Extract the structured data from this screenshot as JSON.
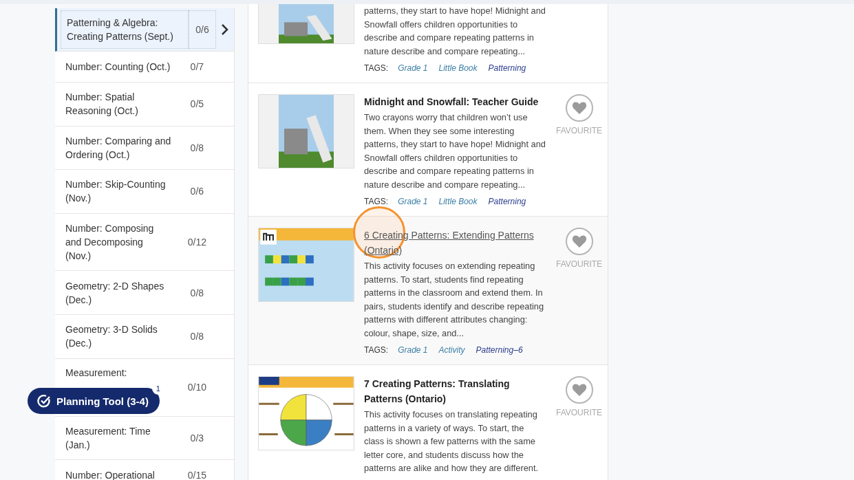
{
  "sidebar": {
    "items": [
      {
        "label": "Patterning & Algebra: Creating Patterns (Sept.)",
        "count": "0/6",
        "selected": true
      },
      {
        "label": "Number: Counting (Oct.)",
        "count": "0/7",
        "selected": false
      },
      {
        "label": "Number: Spatial Reasoning (Oct.)",
        "count": "0/5",
        "selected": false
      },
      {
        "label": "Number: Comparing and Ordering (Oct.)",
        "count": "0/8",
        "selected": false
      },
      {
        "label": "Number: Skip-Counting (Nov.)",
        "count": "0/6",
        "selected": false
      },
      {
        "label": "Number: Composing and Decomposing (Nov.)",
        "count": "0/12",
        "selected": false
      },
      {
        "label": "Geometry: 2-D Shapes (Dec.)",
        "count": "0/8",
        "selected": false
      },
      {
        "label": "Geometry: 3-D Solids (Dec.)",
        "count": "0/8",
        "selected": false
      },
      {
        "label": "Measurement:",
        "count": "0/10",
        "selected": false
      },
      {
        "label": "Measurement: Time (Jan.)",
        "count": "0/3",
        "selected": false
      },
      {
        "label": "Number: Operational",
        "count": "0/15",
        "selected": false
      }
    ]
  },
  "planning_tool": {
    "label": "Planning Tool (3-4)",
    "badge": "1"
  },
  "resources": [
    {
      "kind": "book",
      "description": "patterns, they start to have hope! Midnight and Snowfall offers children opportunities to describe and compare repeating patterns in nature describe and compare repeating...",
      "tags_label": "TAGS:",
      "tags": [
        {
          "label": "Grade 1",
          "color": "#3b7fa6"
        },
        {
          "label": "Little Book",
          "color": "#3b7fa6"
        },
        {
          "label": "Patterning",
          "color": "#2b3e8e"
        }
      ],
      "hovered": false
    },
    {
      "kind": "book",
      "title": "Midnight and Snowfall: Teacher Guide",
      "description": "Two crayons worry that children won’t use them. When they see some interesting patterns, they start to have hope! Midnight and Snowfall offers children opportunities to describe and compare repeating patterns in nature describe and compare repeating...",
      "tags_label": "TAGS:",
      "tags": [
        {
          "label": "Grade 1",
          "color": "#3b7fa6"
        },
        {
          "label": "Little Book",
          "color": "#3b7fa6"
        },
        {
          "label": "Patterning",
          "color": "#2b3e8e"
        }
      ],
      "favourite": "FAVOURITE",
      "hovered": false
    },
    {
      "kind": "squares",
      "title": "6 Creating Patterns: Extending Patterns (Ontario)",
      "description": "This activity focuses on extending repeating patterns. To start, students find repeating patterns in the classroom and extend them. In pairs, students identify and describe repeating patterns with different attributes changing: colour, shape, size, and...",
      "tags_label": "TAGS:",
      "tags": [
        {
          "label": "Grade 1",
          "color": "#3b7fa6"
        },
        {
          "label": "Activity",
          "color": "#3b7fa6"
        },
        {
          "label": "Patterning–6",
          "color": "#2b3e8e"
        }
      ],
      "favourite": "FAVOURITE",
      "hovered": true
    },
    {
      "kind": "circle",
      "title": "7 Creating Patterns: Translating Patterns (Ontario)",
      "description": "This activity focuses on translating repeating patterns in a variety of ways. To start, the class is shown a few patterns with the same letter core, and students discuss how the patterns are alike and how they are different.",
      "favourite": "FAVOURITE",
      "hovered": false
    }
  ]
}
